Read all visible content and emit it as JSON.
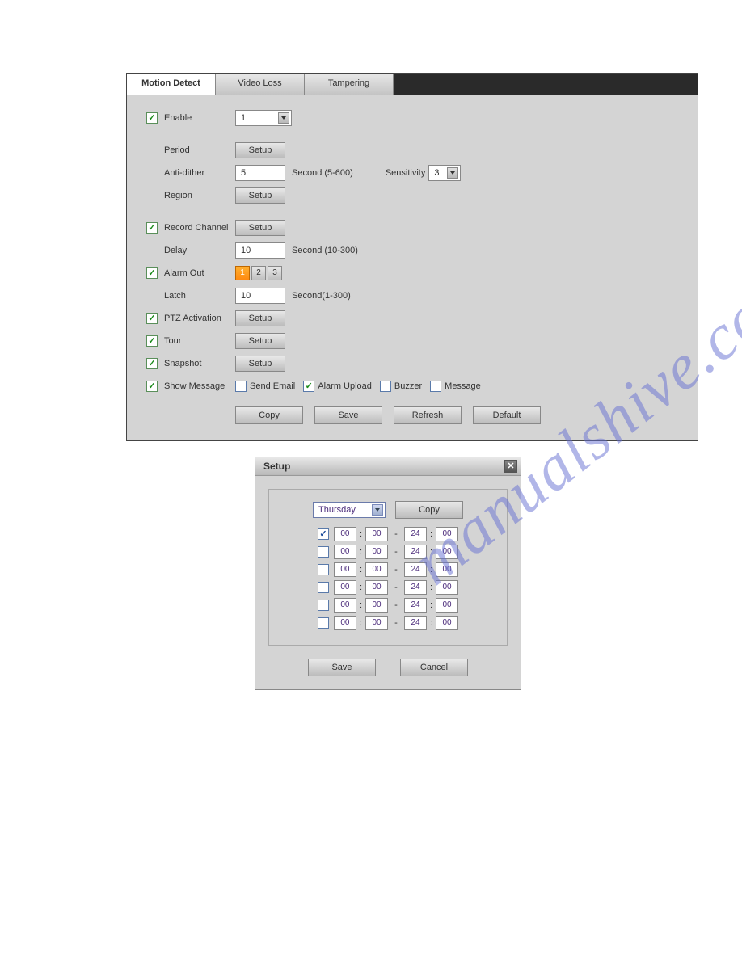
{
  "tabs": {
    "motion_detect": "Motion Detect",
    "video_loss": "Video Loss",
    "tampering": "Tampering"
  },
  "labels": {
    "enable": "Enable",
    "period": "Period",
    "anti_dither": "Anti-dither",
    "region": "Region",
    "record_channel": "Record Channel",
    "delay": "Delay",
    "alarm_out": "Alarm Out",
    "latch": "Latch",
    "ptz_activation": "PTZ Activation",
    "tour": "Tour",
    "snapshot": "Snapshot",
    "show_message": "Show Message",
    "sensitivity": "Sensitivity",
    "send_email": "Send Email",
    "alarm_upload": "Alarm Upload",
    "buzzer": "Buzzer",
    "message": "Message"
  },
  "values": {
    "channel": "1",
    "anti_dither": "5",
    "sensitivity": "3",
    "delay": "10",
    "latch": "10"
  },
  "hints": {
    "anti_dither": "Second (5-600)",
    "delay": "Second (10-300)",
    "latch": "Second(1-300)"
  },
  "alarm_out_buttons": [
    "1",
    "2",
    "3"
  ],
  "buttons": {
    "setup": "Setup",
    "copy": "Copy",
    "save": "Save",
    "refresh": "Refresh",
    "default": "Default",
    "cancel": "Cancel"
  },
  "modal": {
    "title": "Setup",
    "day": "Thursday",
    "rows": [
      {
        "enabled": true,
        "h1": "00",
        "m1": "00",
        "h2": "24",
        "m2": "00"
      },
      {
        "enabled": false,
        "h1": "00",
        "m1": "00",
        "h2": "24",
        "m2": "00"
      },
      {
        "enabled": false,
        "h1": "00",
        "m1": "00",
        "h2": "24",
        "m2": "00"
      },
      {
        "enabled": false,
        "h1": "00",
        "m1": "00",
        "h2": "24",
        "m2": "00"
      },
      {
        "enabled": false,
        "h1": "00",
        "m1": "00",
        "h2": "24",
        "m2": "00"
      },
      {
        "enabled": false,
        "h1": "00",
        "m1": "00",
        "h2": "24",
        "m2": "00"
      }
    ]
  },
  "watermark": "manualshive.com"
}
